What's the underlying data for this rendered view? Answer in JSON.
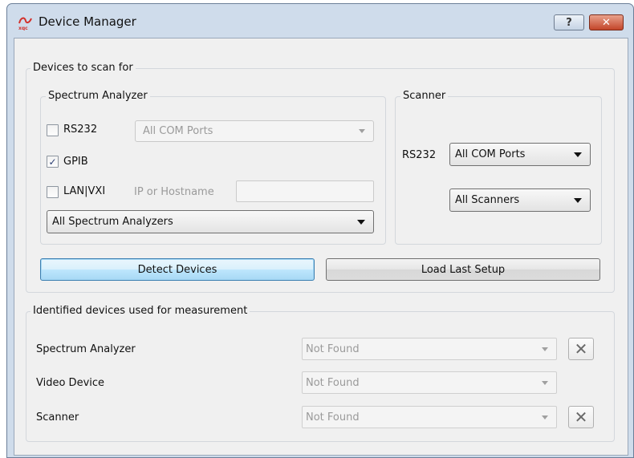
{
  "window": {
    "title": "Device Manager",
    "help_label": "?",
    "close_label": "✕",
    "app_icon": "xqc-logo-icon"
  },
  "scan": {
    "group_title": "Devices to scan for",
    "spectrum": {
      "group_title": "Spectrum Analyzer",
      "rs232": {
        "label": "RS232",
        "checked": false,
        "mark": "",
        "combo_value": "All COM Ports"
      },
      "gpib": {
        "label": "GPIB",
        "checked": true,
        "mark": "✓"
      },
      "lan": {
        "label": "LAN|VXI",
        "checked": false,
        "mark": "",
        "ip_label": "IP or Hostname",
        "ip_value": ""
      },
      "analyzer_combo_value": "All Spectrum Analyzers"
    },
    "scanner": {
      "group_title": "Scanner",
      "rs232_label": "RS232",
      "com_combo_value": "All COM Ports",
      "scanners_combo_value": "All Scanners"
    },
    "detect_button": "Detect Devices",
    "load_button": "Load Last Setup"
  },
  "identified": {
    "group_title": "Identified devices used for measurement",
    "rows": [
      {
        "label": "Spectrum Analyzer",
        "value": "Not Found",
        "has_clear": true
      },
      {
        "label": "Video Device",
        "value": "Not Found",
        "has_clear": false
      },
      {
        "label": "Scanner",
        "value": "Not Found",
        "has_clear": true
      }
    ],
    "clear_glyph": "✕"
  },
  "colors": {
    "title_bg": "#cfdceb",
    "client_bg": "#f0f0f0",
    "close_red": "#c3452a",
    "focus_blue": "#3c7fb1"
  }
}
